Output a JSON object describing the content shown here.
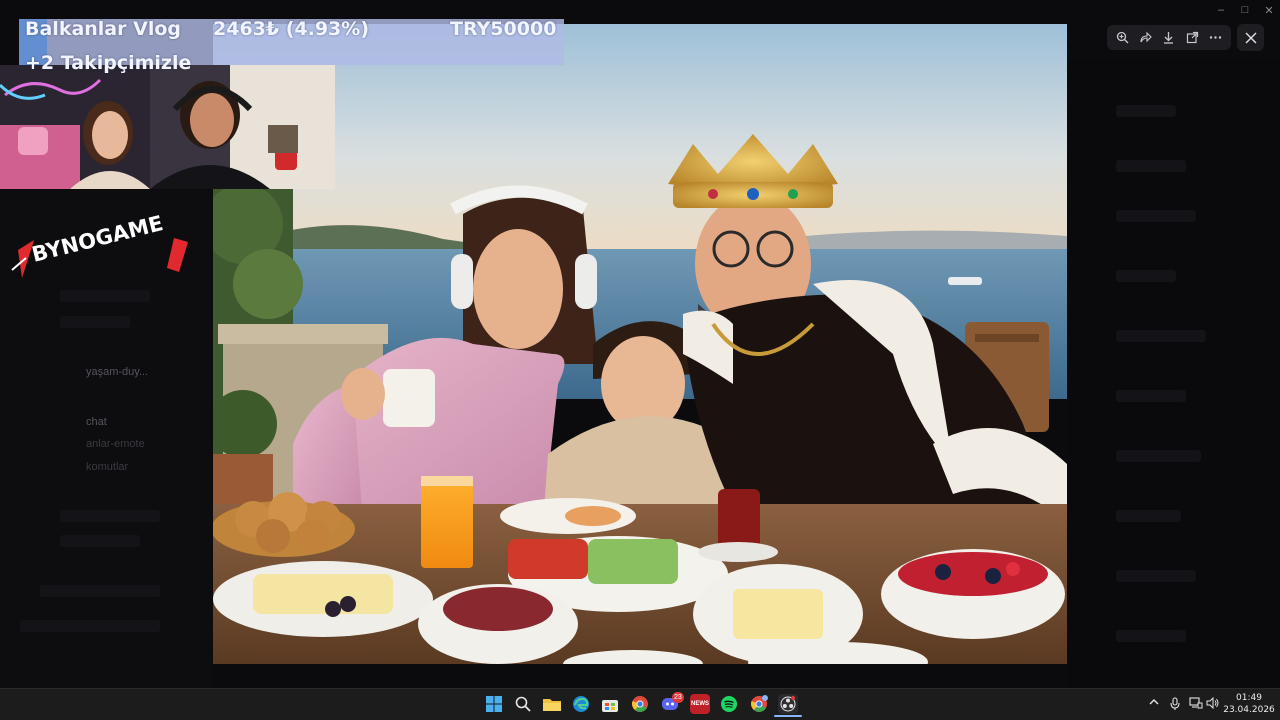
{
  "overlay": {
    "donation_name": "Balkanlar Vlog",
    "donation_amount": "2463₺ (4.93%)",
    "donation_goal": "TRY50000",
    "follower_line": "+2 Takipçimizle",
    "progress_fraction": 0.0493,
    "accent_color": "#5a8cd2"
  },
  "brand": {
    "logo_text": "BYNOGAME"
  },
  "viewer": {
    "toolbar_icons": [
      "zoom-in-icon",
      "share-icon",
      "download-icon",
      "open-external-icon",
      "more-icon"
    ],
    "close_icon": "close-icon"
  },
  "background_app": {
    "channels": [
      "yaşam-duy...",
      "chat",
      "anlar-emote",
      "komutlar"
    ]
  },
  "taskbar": {
    "apps": [
      "start-icon",
      "search-icon",
      "file-explorer-icon",
      "edge-icon",
      "store-icon",
      "chrome-icon",
      "discord-icon",
      "news-app-icon",
      "spotify-icon",
      "chrome-profile-icon",
      "obs-icon"
    ],
    "discord_badge": "23",
    "news_label": "NEWS",
    "clock_time": "01:49",
    "clock_date": "23.04.2026"
  }
}
